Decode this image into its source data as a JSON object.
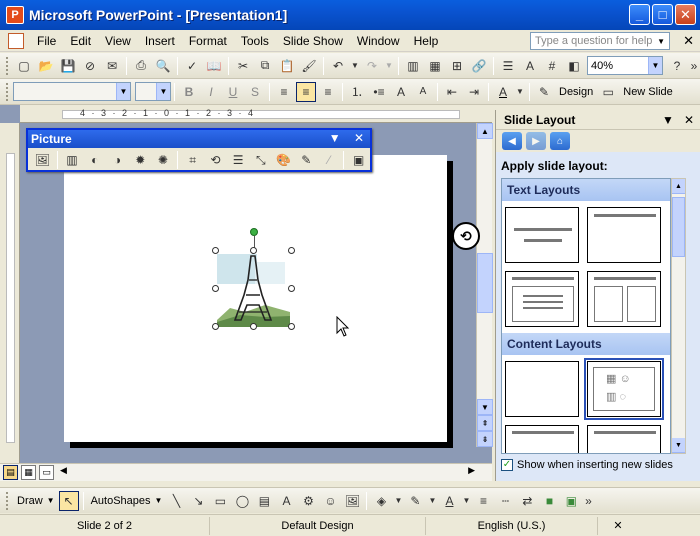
{
  "window": {
    "title": "Microsoft PowerPoint - [Presentation1]"
  },
  "menu": {
    "items": [
      "File",
      "Edit",
      "View",
      "Insert",
      "Format",
      "Tools",
      "Slide Show",
      "Window",
      "Help"
    ],
    "ask_placeholder": "Type a question for help"
  },
  "standard_toolbar": {
    "zoom": "40%"
  },
  "formatting_toolbar": {
    "font_name": "",
    "font_size": "",
    "design_label": "Design",
    "new_slide_label": "New Slide"
  },
  "ruler": {
    "h_numbers": "4 · 3 · 2 · 1 · 0 · 1 · 2 · 3 · 4"
  },
  "picture_toolbar": {
    "title": "Picture"
  },
  "task_pane": {
    "title": "Slide Layout",
    "apply_label": "Apply slide layout:",
    "sections": [
      "Text Layouts",
      "Content Layouts"
    ],
    "show_label": "Show when inserting new slides"
  },
  "draw_toolbar": {
    "draw_label": "Draw",
    "autoshapes_label": "AutoShapes"
  },
  "status": {
    "slide": "Slide 2 of 2",
    "design": "Default Design",
    "language": "English (U.S.)"
  },
  "colors": {
    "title_bar": "#0a5ede",
    "workspace": "#8c9ab5",
    "task_pane": "#dde7f7"
  }
}
